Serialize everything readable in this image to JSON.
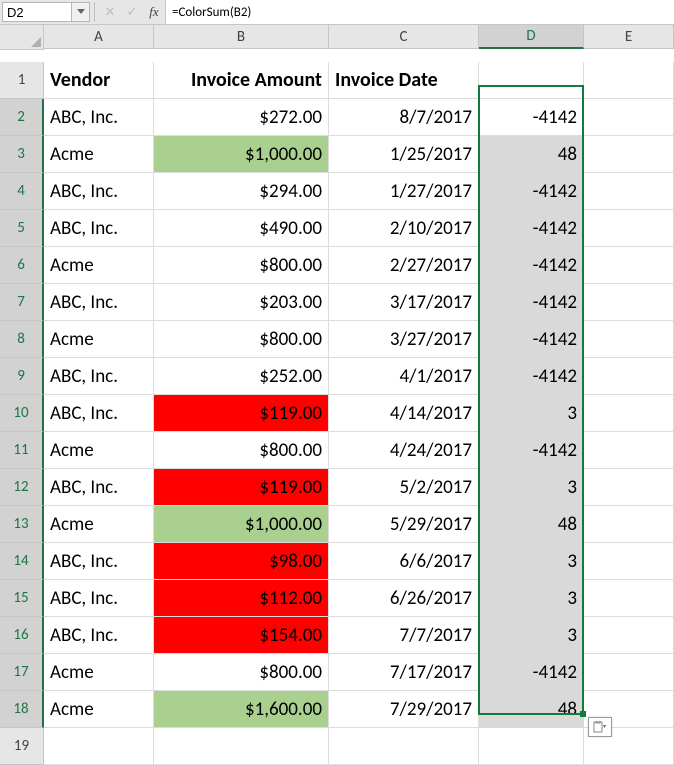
{
  "namebox": "D2",
  "formula": "=ColorSum(B2)",
  "columns": [
    "A",
    "B",
    "C",
    "D",
    "E"
  ],
  "selected_column": "D",
  "active_cell_row": 2,
  "headers": {
    "A": "Vendor",
    "B": "Invoice Amount",
    "C": "Invoice Date",
    "D": ""
  },
  "selection": {
    "col": "D",
    "row_start": 2,
    "row_end": 18
  },
  "rows": [
    {
      "n": 1
    },
    {
      "n": 2,
      "A": "ABC, Inc.",
      "B": "$272.00",
      "B_fill": "",
      "C": "8/7/2017",
      "D": "-4142"
    },
    {
      "n": 3,
      "A": "Acme",
      "B": "$1,000.00",
      "B_fill": "green",
      "C": "1/25/2017",
      "D": "48"
    },
    {
      "n": 4,
      "A": "ABC, Inc.",
      "B": "$294.00",
      "B_fill": "",
      "C": "1/27/2017",
      "D": "-4142"
    },
    {
      "n": 5,
      "A": "ABC, Inc.",
      "B": "$490.00",
      "B_fill": "",
      "C": "2/10/2017",
      "D": "-4142"
    },
    {
      "n": 6,
      "A": "Acme",
      "B": "$800.00",
      "B_fill": "",
      "C": "2/27/2017",
      "D": "-4142"
    },
    {
      "n": 7,
      "A": "ABC, Inc.",
      "B": "$203.00",
      "B_fill": "",
      "C": "3/17/2017",
      "D": "-4142"
    },
    {
      "n": 8,
      "A": "Acme",
      "B": "$800.00",
      "B_fill": "",
      "C": "3/27/2017",
      "D": "-4142"
    },
    {
      "n": 9,
      "A": "ABC, Inc.",
      "B": "$252.00",
      "B_fill": "",
      "C": "4/1/2017",
      "D": "-4142"
    },
    {
      "n": 10,
      "A": "ABC, Inc.",
      "B": "$119.00",
      "B_fill": "red",
      "C": "4/14/2017",
      "D": "3"
    },
    {
      "n": 11,
      "A": "Acme",
      "B": "$800.00",
      "B_fill": "",
      "C": "4/24/2017",
      "D": "-4142"
    },
    {
      "n": 12,
      "A": "ABC, Inc.",
      "B": "$119.00",
      "B_fill": "red",
      "C": "5/2/2017",
      "D": "3"
    },
    {
      "n": 13,
      "A": "Acme",
      "B": "$1,000.00",
      "B_fill": "green",
      "C": "5/29/2017",
      "D": "48"
    },
    {
      "n": 14,
      "A": "ABC, Inc.",
      "B": "$98.00",
      "B_fill": "red",
      "C": "6/6/2017",
      "D": "3"
    },
    {
      "n": 15,
      "A": "ABC, Inc.",
      "B": "$112.00",
      "B_fill": "red",
      "C": "6/26/2017",
      "D": "3"
    },
    {
      "n": 16,
      "A": "ABC, Inc.",
      "B": "$154.00",
      "B_fill": "red",
      "C": "7/7/2017",
      "D": "3"
    },
    {
      "n": 17,
      "A": "Acme",
      "B": "$800.00",
      "B_fill": "",
      "C": "7/17/2017",
      "D": "-4142"
    },
    {
      "n": 18,
      "A": "Acme",
      "B": "$1,600.00",
      "B_fill": "green",
      "C": "7/29/2017",
      "D": "48"
    },
    {
      "n": 19
    }
  ],
  "chart_data": {
    "type": "table",
    "columns": [
      "Vendor",
      "Invoice Amount",
      "Invoice Date",
      "ColorSum"
    ],
    "rows": [
      [
        "ABC, Inc.",
        272.0,
        "2017-08-07",
        -4142
      ],
      [
        "Acme",
        1000.0,
        "2017-01-25",
        48
      ],
      [
        "ABC, Inc.",
        294.0,
        "2017-01-27",
        -4142
      ],
      [
        "ABC, Inc.",
        490.0,
        "2017-02-10",
        -4142
      ],
      [
        "Acme",
        800.0,
        "2017-02-27",
        -4142
      ],
      [
        "ABC, Inc.",
        203.0,
        "2017-03-17",
        -4142
      ],
      [
        "Acme",
        800.0,
        "2017-03-27",
        -4142
      ],
      [
        "ABC, Inc.",
        252.0,
        "2017-04-01",
        -4142
      ],
      [
        "ABC, Inc.",
        119.0,
        "2017-04-14",
        3
      ],
      [
        "Acme",
        800.0,
        "2017-04-24",
        -4142
      ],
      [
        "ABC, Inc.",
        119.0,
        "2017-05-02",
        3
      ],
      [
        "Acme",
        1000.0,
        "2017-05-29",
        48
      ],
      [
        "ABC, Inc.",
        98.0,
        "2017-06-06",
        3
      ],
      [
        "ABC, Inc.",
        112.0,
        "2017-06-26",
        3
      ],
      [
        "ABC, Inc.",
        154.0,
        "2017-07-07",
        3
      ],
      [
        "Acme",
        800.0,
        "2017-07-17",
        -4142
      ],
      [
        "Acme",
        1600.0,
        "2017-07-29",
        48
      ]
    ]
  }
}
